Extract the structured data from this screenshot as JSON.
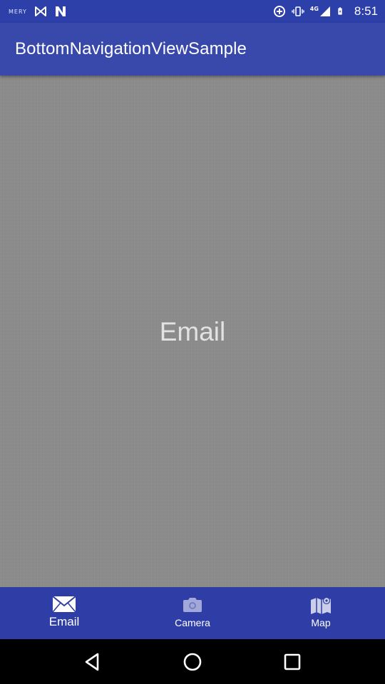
{
  "status_bar": {
    "carrier": "MERY",
    "network": "4G",
    "time": "8:51"
  },
  "app_bar": {
    "title": "BottomNavigationViewSample"
  },
  "content": {
    "label": "Email"
  },
  "bottom_nav": {
    "items": [
      {
        "label": "Email",
        "icon": "email-icon",
        "active": true
      },
      {
        "label": "Camera",
        "icon": "camera-icon",
        "active": false
      },
      {
        "label": "Map",
        "icon": "map-icon",
        "active": false
      }
    ]
  },
  "system_nav": {
    "buttons": [
      "back-icon",
      "home-icon",
      "recents-icon"
    ]
  },
  "colors": {
    "primary": "#3949ab",
    "status_bar": "#2d3fa8",
    "bottom_nav": "#2f3ea6",
    "content_bg": "#8c8c8c",
    "content_text": "#e2e2e2"
  }
}
